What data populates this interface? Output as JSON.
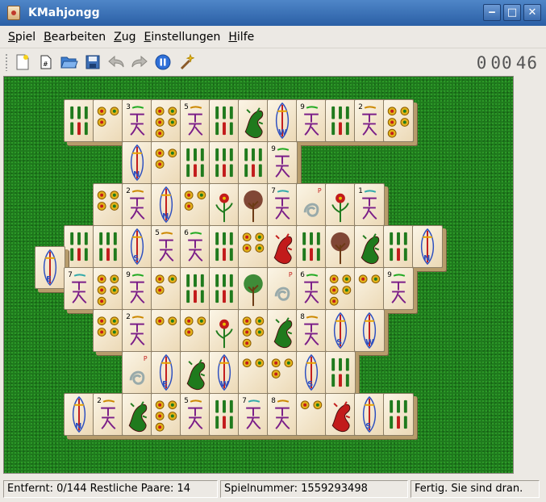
{
  "window": {
    "title": "KMahjongg",
    "minimize": "‒",
    "maximize": "□",
    "close": "✕"
  },
  "menu": [
    {
      "label": "Spiel",
      "name": "menu-spiel"
    },
    {
      "label": "Bearbeiten",
      "name": "menu-bearbeiten"
    },
    {
      "label": "Zug",
      "name": "menu-zug"
    },
    {
      "label": "Einstellungen",
      "name": "menu-einstellungen"
    },
    {
      "label": "Hilfe",
      "name": "menu-hilfe"
    }
  ],
  "toolbar": {
    "icons": [
      "new-game-icon",
      "game-number-icon",
      "open-icon",
      "save-icon",
      "undo-icon",
      "redo-icon",
      "pause-icon",
      "hint-wand-icon"
    ],
    "timer": {
      "hours": "0",
      "minutes": "00",
      "seconds": "46"
    }
  },
  "board": {
    "background_color": "#1f7a1d",
    "tiles": [
      "bamboo",
      "circles",
      "character",
      "circles",
      "character",
      "bamboo",
      "dragon-red-flower",
      "wind",
      "character",
      "bamboo",
      "character",
      "circles",
      "wind",
      "circles",
      "bamboo",
      "bamboo",
      "bamboo",
      "character",
      "circles",
      "character",
      "wind",
      "circles",
      "flower",
      "tree",
      "character",
      "season",
      "flower",
      "character",
      "bamboo",
      "bamboo",
      "wind",
      "character",
      "character",
      "bamboo",
      "circles",
      "dragon",
      "bamboo",
      "tree",
      "dragon",
      "bamboo",
      "wind",
      "wind",
      "character",
      "circles",
      "character",
      "circles",
      "bamboo",
      "bamboo",
      "tree",
      "season",
      "character",
      "circles",
      "circles",
      "character",
      "circles",
      "character",
      "circles",
      "circles",
      "flower",
      "circles",
      "dragon",
      "character",
      "wind",
      "wind",
      "season",
      "wind",
      "dragon",
      "wind",
      "circles",
      "circles",
      "wind",
      "bamboo",
      "wind",
      "character",
      "dragon",
      "circles",
      "character",
      "bamboo",
      "character",
      "character",
      "circles",
      "dragon",
      "wind",
      "bamboo",
      "character"
    ]
  },
  "status": {
    "removed": "Entfernt: 0/144 Restliche Paare: 14",
    "game_number": "Spielnummer: 1559293498",
    "message": "Fertig. Sie sind dran."
  }
}
